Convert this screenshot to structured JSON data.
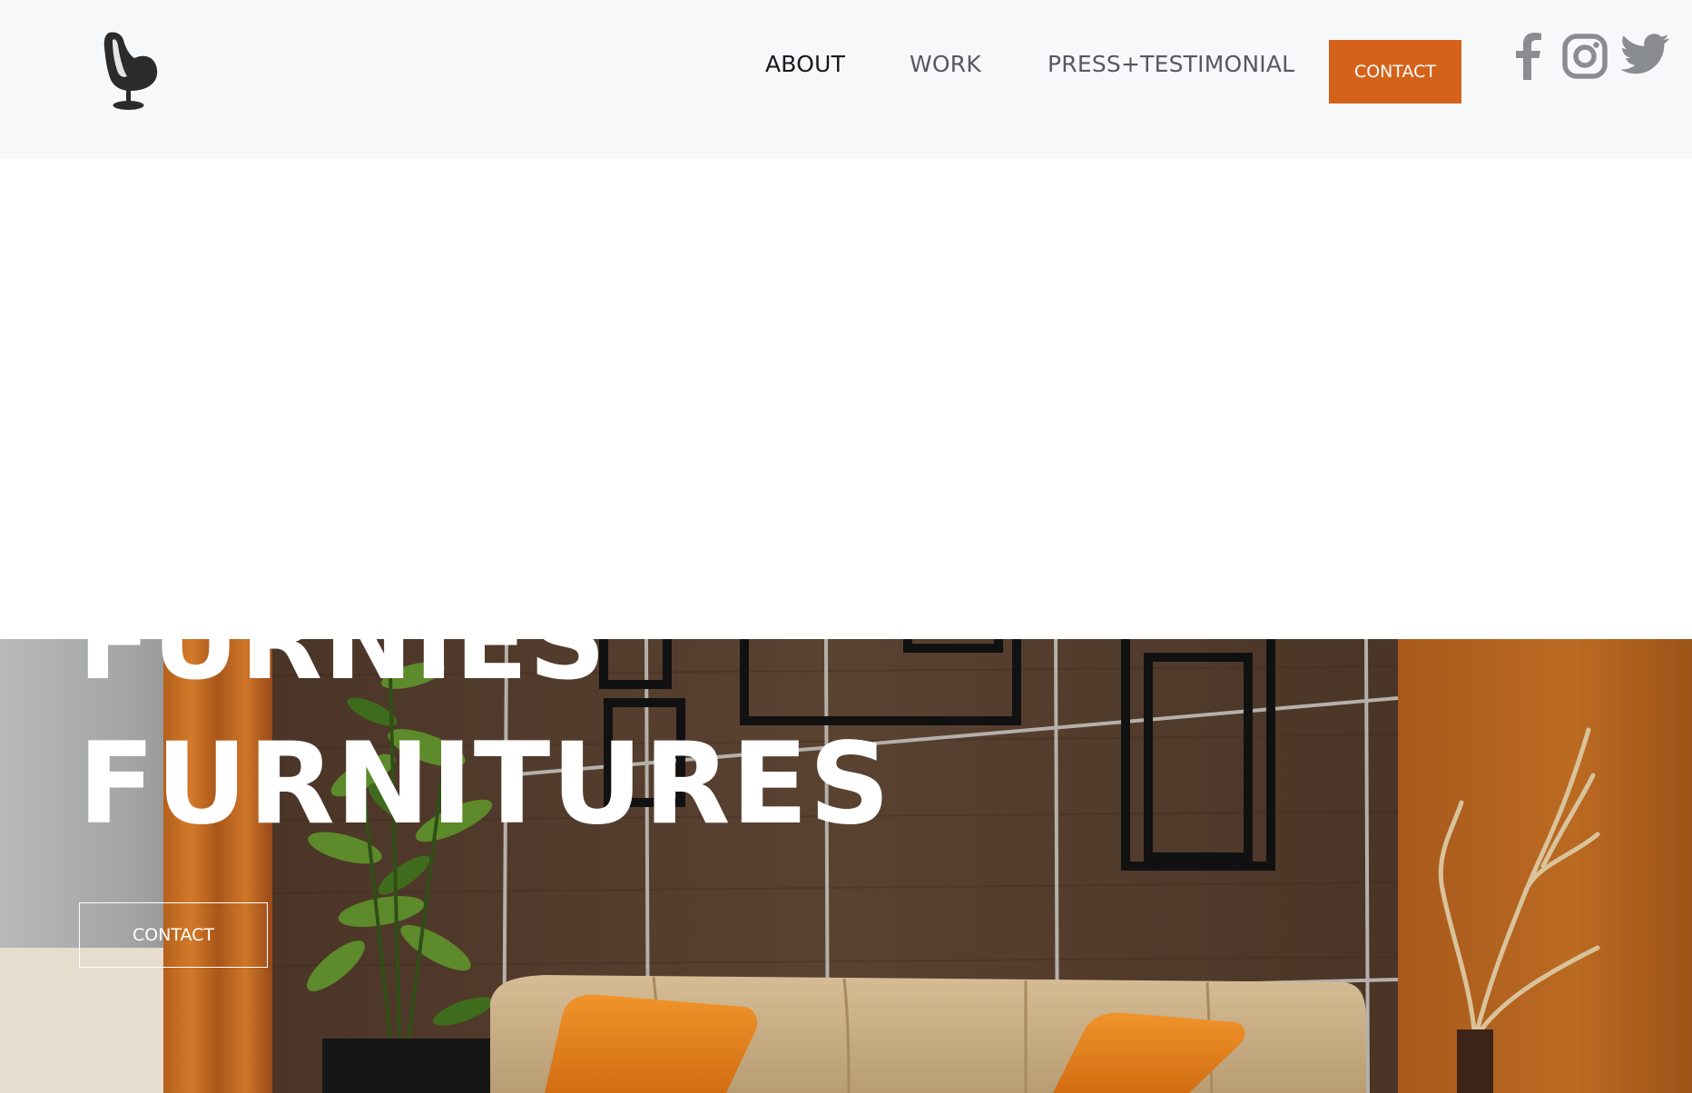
{
  "header": {
    "logo_icon": "egg-chair-icon",
    "nav": {
      "about": "ABOUT",
      "work": "WORK",
      "press": "PRESS+TESTIMONIAL"
    },
    "contact_label": "CONTACT",
    "social": [
      "facebook-icon",
      "instagram-icon",
      "twitter-icon"
    ]
  },
  "hero": {
    "line_1": "FURNIES",
    "line_2": "FURNITURES",
    "contact_label": "CONTACT"
  },
  "colors": {
    "accent": "#d4621a",
    "header_bg": "#f7f8f9",
    "icon_gray": "#8a8d90",
    "logo_dark": "#2b2b2b"
  }
}
